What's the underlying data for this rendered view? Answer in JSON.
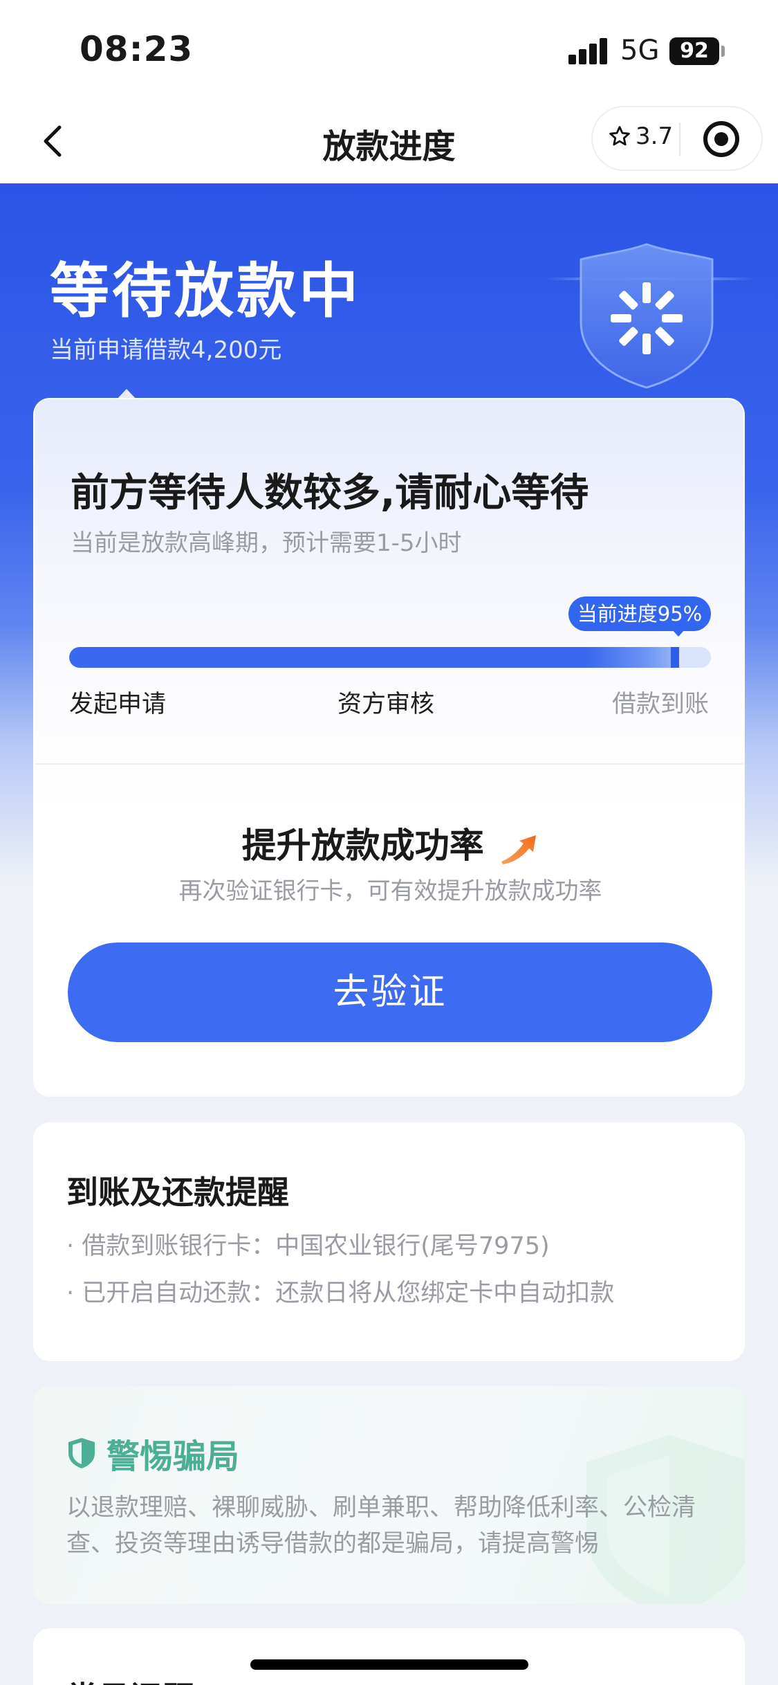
{
  "status_bar": {
    "time": "08:23",
    "network": "5G",
    "battery": "92"
  },
  "nav": {
    "title": "放款进度",
    "rating": "3.7",
    "back_icon": "chevron-left-icon",
    "more_icon": "target-icon"
  },
  "hero": {
    "title": "等待放款中",
    "subtitle": "当前申请借款4,200元"
  },
  "progress_card": {
    "title": "前方等待人数较多,请耐心等待",
    "subtitle": "当前是放款高峰期，预计需要1-5小时",
    "badge": "当前进度95%",
    "progress": 0.95,
    "steps": [
      "发起申请",
      "资方审核",
      "借款到账"
    ],
    "boost_title": "提升放款成功率",
    "boost_subtitle": "再次验证银行卡，可有效提升放款成功率",
    "button_label": "去验证"
  },
  "reminder_card": {
    "title": "到账及还款提醒",
    "line1": "· 借款到账银行卡：中国农业银行(尾号7975)",
    "line2": "· 已开启自动还款：还款日将从您绑定卡中自动扣款"
  },
  "fraud_card": {
    "title": "警惕骗局",
    "text": "以退款理赔、裸聊威胁、刷单兼职、帮助降低利率、公检清查、投资等理由诱导借款的都是骗局，请提高警惕"
  },
  "faq_card": {
    "title": "常见问题"
  },
  "colors": {
    "primary": "#3d6cf2",
    "hero_top": "#2b54e6",
    "fraud_green": "#4caf95"
  }
}
